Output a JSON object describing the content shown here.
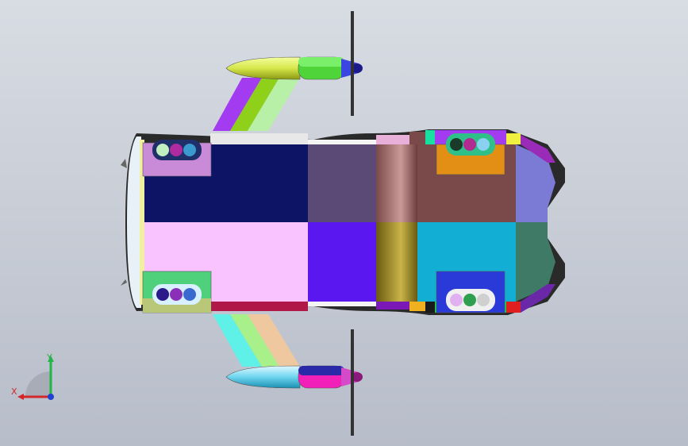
{
  "viewport": {
    "background_top": "#d8dce3",
    "background_bottom": "#b7bdc9"
  },
  "triad": {
    "x_label": "X",
    "y_label": "Y",
    "x_color": "#d2262b",
    "y_color": "#26b34a",
    "z_color": "#2040d0"
  },
  "model": {
    "icon": "3d-model-top-view",
    "palette": {
      "navy": "#0d1466",
      "pink": "#f9c3ff",
      "slate": "#5c4a76",
      "indigo": "#5b17f0",
      "brown": "#7a4a4a",
      "cyan": "#12aed4",
      "olive": "#8b7a1c",
      "periwinkle": "#7b7ad4",
      "teal": "#3f7a66",
      "orange": "#e38e15"
    }
  }
}
